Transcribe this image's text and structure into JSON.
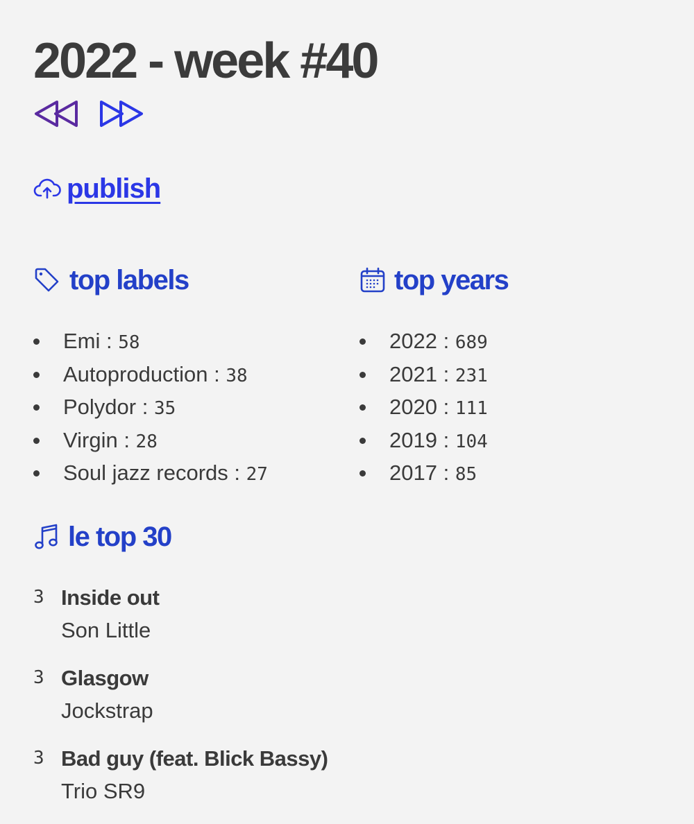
{
  "header": {
    "title": "2022 - week #40"
  },
  "nav": {
    "prev_icon": "rewind-icon",
    "next_icon": "fast-forward-icon",
    "prev_color": "#5a2aa0",
    "next_color": "#2b37e6"
  },
  "publish": {
    "label": "publish",
    "icon": "cloud-upload-icon",
    "color": "#2b37e6"
  },
  "top_labels": {
    "title": "top labels",
    "icon": "tag-icon",
    "items": [
      {
        "name": "Emi",
        "count": "58"
      },
      {
        "name": "Autoproduction",
        "count": "38"
      },
      {
        "name": "Polydor",
        "count": "35"
      },
      {
        "name": "Virgin",
        "count": "28"
      },
      {
        "name": "Soul jazz records",
        "count": "27"
      }
    ]
  },
  "top_years": {
    "title": "top years",
    "icon": "calendar-icon",
    "items": [
      {
        "name": "2022",
        "count": "689"
      },
      {
        "name": "2021",
        "count": "231"
      },
      {
        "name": "2020",
        "count": "111"
      },
      {
        "name": "2019",
        "count": "104"
      },
      {
        "name": "2017",
        "count": "85"
      }
    ]
  },
  "top30": {
    "title": "le top 30",
    "icon": "music-note-icon",
    "tracks": [
      {
        "rank": "3",
        "title": "Inside out",
        "artist": "Son Little"
      },
      {
        "rank": "3",
        "title": "Glasgow",
        "artist": "Jockstrap"
      },
      {
        "rank": "3",
        "title": "Bad guy (feat. Blick Bassy)",
        "artist": "Trio SR9"
      }
    ]
  },
  "colors": {
    "background": "#f3f3f3",
    "text": "#3a3a3a",
    "heading_blue": "#2340c8",
    "link_blue": "#2b37e6"
  }
}
